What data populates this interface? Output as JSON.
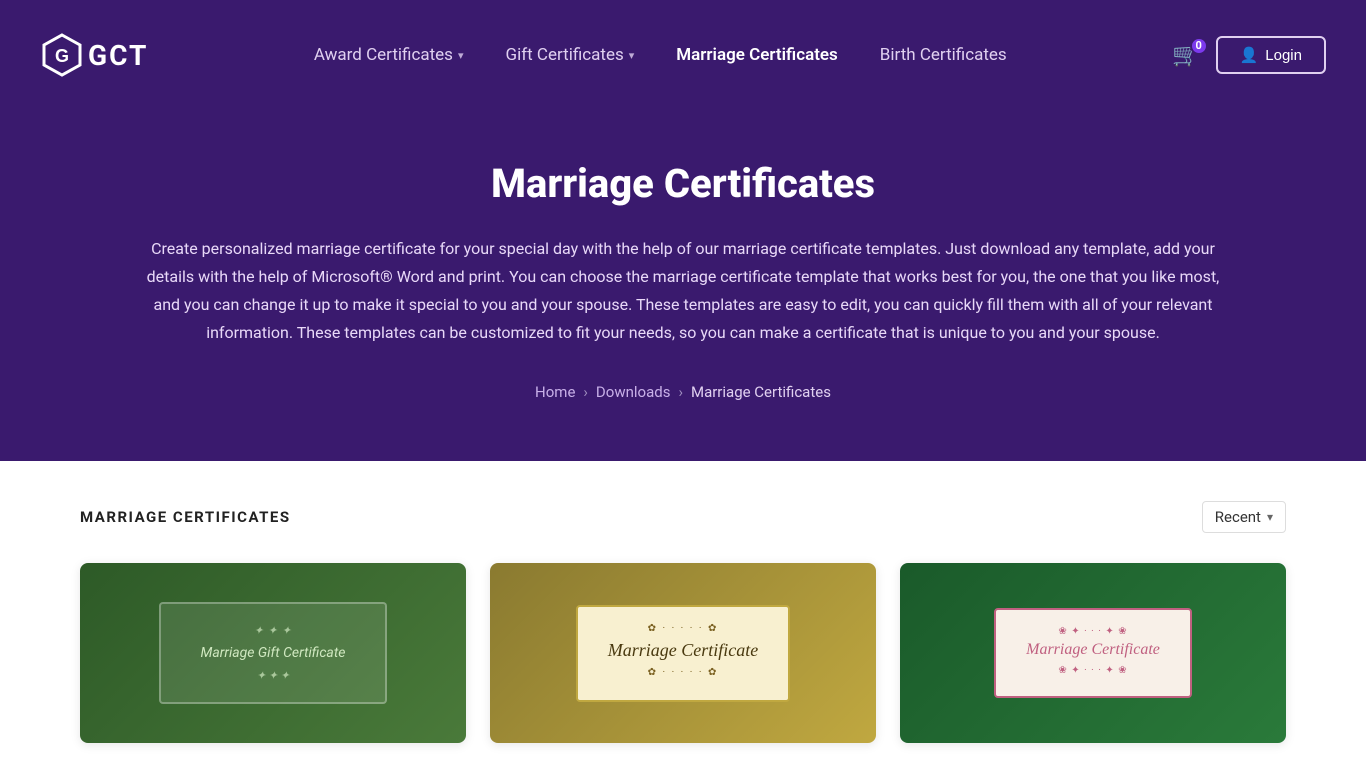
{
  "site": {
    "logo_letters": "GCT",
    "logo_hex_color": "#fff"
  },
  "navbar": {
    "award_certificates_label": "Award Certificates",
    "gift_certificates_label": "Gift Certificates",
    "marriage_certificates_label": "Marriage Certificates",
    "birth_certificates_label": "Birth Certificates",
    "cart_count": "0",
    "login_label": "Login"
  },
  "hero": {
    "title": "Marriage Certificates",
    "description": "Create personalized marriage certificate for your special day with the help of our marriage certificate templates. Just download any template, add your details with the help of Microsoft® Word and print. You can choose the marriage certificate template that works best for you, the one that you like most, and you can change it up to make it special to you and your spouse. These templates are easy to edit, you can quickly fill them with all of your relevant information. These templates can be customized to fit your needs, so you can make a certificate that is unique to you and your spouse.",
    "breadcrumb_home": "Home",
    "breadcrumb_downloads": "Downloads",
    "breadcrumb_current": "Marriage Certificates"
  },
  "content": {
    "section_title": "MARRIAGE CERTIFICATES",
    "sort_label": "Recent",
    "cards": [
      {
        "id": 1,
        "alt": "Marriage Gift Certificate - dark green",
        "cert_label": "Marriage Gift Certificate",
        "style": "card1"
      },
      {
        "id": 2,
        "alt": "Marriage Certificate - golden",
        "cert_label": "Marriage Certificate",
        "style": "card2"
      },
      {
        "id": 3,
        "alt": "Marriage Certificate - green with pink",
        "cert_label": "Marriage Certificate",
        "style": "card3"
      }
    ]
  }
}
